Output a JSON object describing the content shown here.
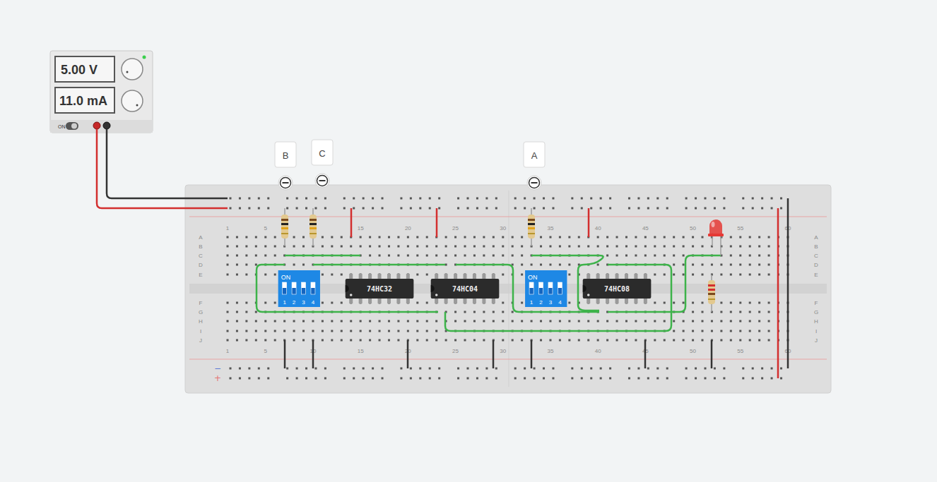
{
  "power_supply": {
    "voltage": "5.00 V",
    "current": "11.0 mA",
    "switch_label": "ON",
    "on": true
  },
  "probes": [
    {
      "label": "B"
    },
    {
      "label": "C"
    },
    {
      "label": "A"
    }
  ],
  "breadboard": {
    "column_numbers": [
      "1",
      "5",
      "10",
      "15",
      "20",
      "25",
      "30",
      "35",
      "40",
      "45",
      "50",
      "55",
      "60"
    ],
    "row_letters": [
      "A",
      "B",
      "C",
      "D",
      "E",
      "F",
      "G",
      "H",
      "I",
      "J"
    ],
    "rail_signs": [
      "−",
      "+"
    ]
  },
  "chips": [
    {
      "label": "74HC32"
    },
    {
      "label": "74HC04"
    },
    {
      "label": "74HC08"
    }
  ],
  "dip_switches": [
    {
      "label": "ON",
      "switches": [
        {
          "number": "1",
          "on": true
        },
        {
          "number": "2",
          "on": true
        },
        {
          "number": "3",
          "on": true
        },
        {
          "number": "4",
          "on": true
        }
      ]
    },
    {
      "label": "ON",
      "switches": [
        {
          "number": "1",
          "on": true
        },
        {
          "number": "2",
          "on": true
        },
        {
          "number": "3",
          "on": true
        },
        {
          "number": "4",
          "on": true
        }
      ]
    }
  ],
  "led": {
    "color": "#e53935",
    "lit": false
  }
}
